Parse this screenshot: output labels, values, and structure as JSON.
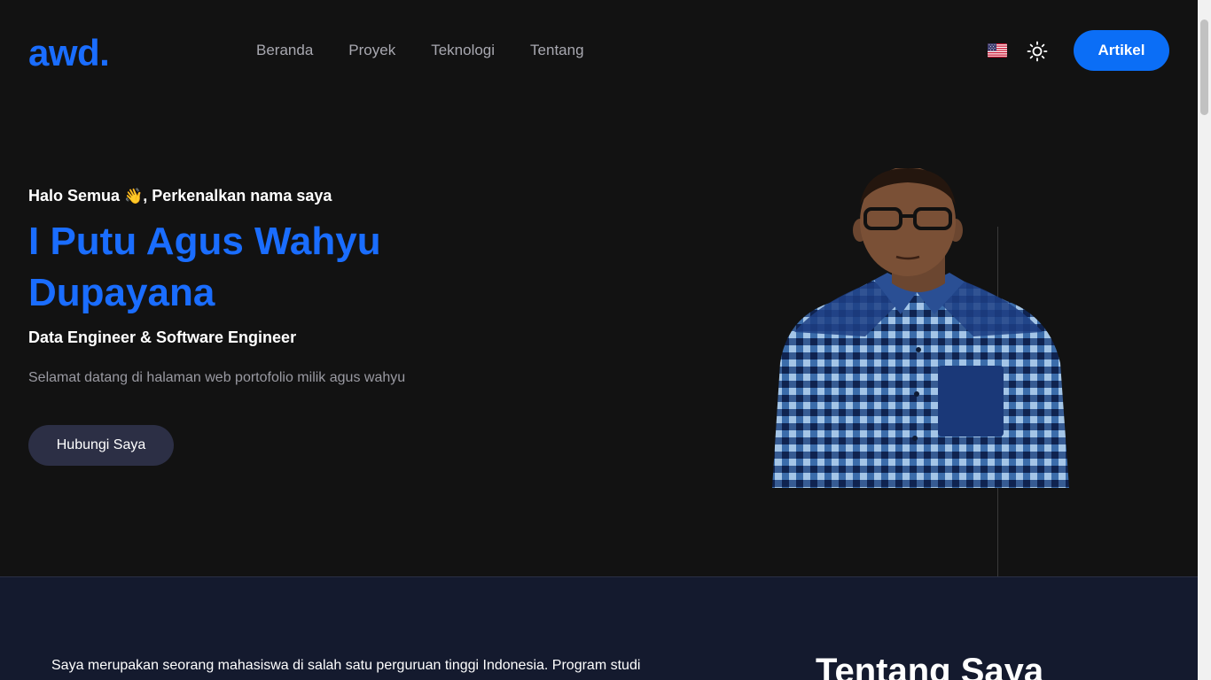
{
  "header": {
    "logo": "awd.",
    "nav": [
      "Beranda",
      "Proyek",
      "Teknologi",
      "Tentang"
    ],
    "language_icon": "us-flag-icon",
    "theme_icon": "sun-icon",
    "cta_label": "Artikel"
  },
  "hero": {
    "greeting_before": "Halo Semua",
    "greeting_emoji": "👋",
    "greeting_after": ", Perkenalkan nama saya",
    "name": "I Putu Agus Wahyu Dupayana",
    "role": "Data Engineer & Software Engineer",
    "description": "Selamat datang di halaman web portofolio milik agus wahyu",
    "contact_label": "Hubungi Saya"
  },
  "about": {
    "text": "Saya merupakan seorang mahasiswa di salah satu perguruan tinggi Indonesia. Program studi",
    "title": "Tentang Saya"
  },
  "colors": {
    "background": "#121212",
    "accent": "#1a6dff",
    "button_primary": "#0b6ef6",
    "button_secondary": "#2c2f45",
    "section_bg": "#141a2e"
  }
}
